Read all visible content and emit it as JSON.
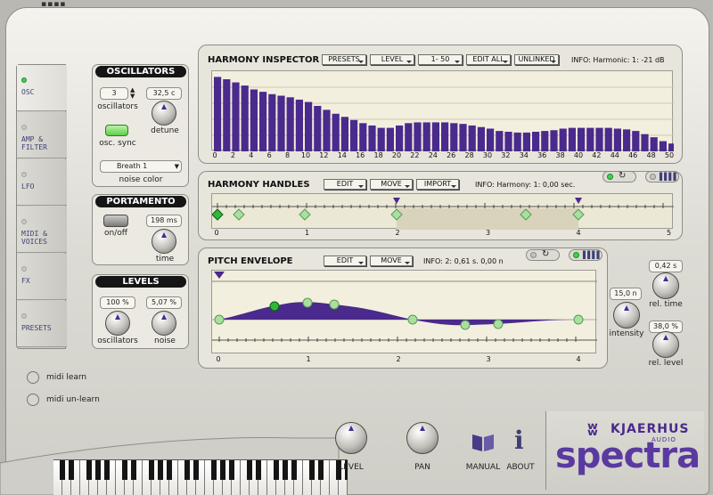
{
  "tabs": [
    {
      "label": "OSC",
      "active": true
    },
    {
      "label": "AMP &\nFILTER",
      "active": false
    },
    {
      "label": "LFO",
      "active": false
    },
    {
      "label": "MIDI &\nVOICES",
      "active": false
    },
    {
      "label": "FX",
      "active": false
    },
    {
      "label": "PRESETS",
      "active": false
    }
  ],
  "oscillators": {
    "title": "OSCILLATORS",
    "count": "3",
    "count_label": "oscillators",
    "detune_value": "32,5 c",
    "detune_label": "detune",
    "sync_label": "osc. sync",
    "noise_color_value": "Breath 1",
    "noise_color_label": "noise color"
  },
  "portamento": {
    "title": "PORTAMENTO",
    "onoff_label": "on/off",
    "time_value": "198 ms",
    "time_label": "time"
  },
  "levels": {
    "title": "LEVELS",
    "osc_value": "100 %",
    "osc_label": "oscillators",
    "noise_value": "5,07 %",
    "noise_label": "noise"
  },
  "midi": {
    "learn": "midi learn",
    "unlearn": "midi un-learn"
  },
  "harmony_inspector": {
    "title": "HARMONY INSPECTOR",
    "buttons": [
      "PRESETS",
      "LEVEL",
      "1- 50",
      "EDIT ALL",
      "UNLINKED"
    ],
    "info": "INFO: Harmonic: 1: -21 dB",
    "ticks": [
      "0",
      "2",
      "4",
      "6",
      "8",
      "10",
      "12",
      "14",
      "16",
      "18",
      "20",
      "22",
      "24",
      "26",
      "28",
      "30",
      "32",
      "34",
      "36",
      "38",
      "40",
      "42",
      "44",
      "46",
      "48",
      "50"
    ]
  },
  "harmony_handles": {
    "title": "HARMONY HANDLES",
    "buttons": [
      "EDIT",
      "MOVE",
      "IMPORT"
    ],
    "info": "INFO: Harmony: 1: 0,00 sec.",
    "ticks": [
      "0",
      "1",
      "2",
      "3",
      "4",
      "5"
    ]
  },
  "pitch_envelope": {
    "title": "PITCH ENVELOPE",
    "buttons": [
      "EDIT",
      "MOVE"
    ],
    "info": "INFO: 2: 0,61 s. 0,00 n",
    "ticks": [
      "0",
      "1",
      "2",
      "3",
      "4"
    ],
    "intensity_value": "15,0 n",
    "intensity_label": "intensity",
    "rel_time_value": "0,42 s",
    "rel_time_label": "rel. time",
    "rel_level_value": "38,0 %",
    "rel_level_label": "rel. level"
  },
  "bottom": {
    "level_label": "LEVEL",
    "pan_label": "PAN",
    "manual_label": "MANUAL",
    "about_label": "ABOUT",
    "brand": "KJAERHUS",
    "brand_sub": "AUDIO",
    "product": "spectra"
  },
  "harmonic_levels": [
    0.95,
    0.92,
    0.88,
    0.84,
    0.79,
    0.76,
    0.73,
    0.71,
    0.69,
    0.66,
    0.63,
    0.58,
    0.53,
    0.48,
    0.44,
    0.4,
    0.36,
    0.33,
    0.3,
    0.3,
    0.33,
    0.36,
    0.37,
    0.37,
    0.37,
    0.37,
    0.36,
    0.35,
    0.33,
    0.31,
    0.29,
    0.26,
    0.25,
    0.24,
    0.24,
    0.25,
    0.26,
    0.27,
    0.29,
    0.3,
    0.3,
    0.3,
    0.3,
    0.3,
    0.29,
    0.28,
    0.26,
    0.22,
    0.18,
    0.13,
    0.1
  ],
  "colors": {
    "accent": "#4a2a8c",
    "led_on": "#3fd24f",
    "panel": "#e7e5dc",
    "area": "#f3efde"
  }
}
